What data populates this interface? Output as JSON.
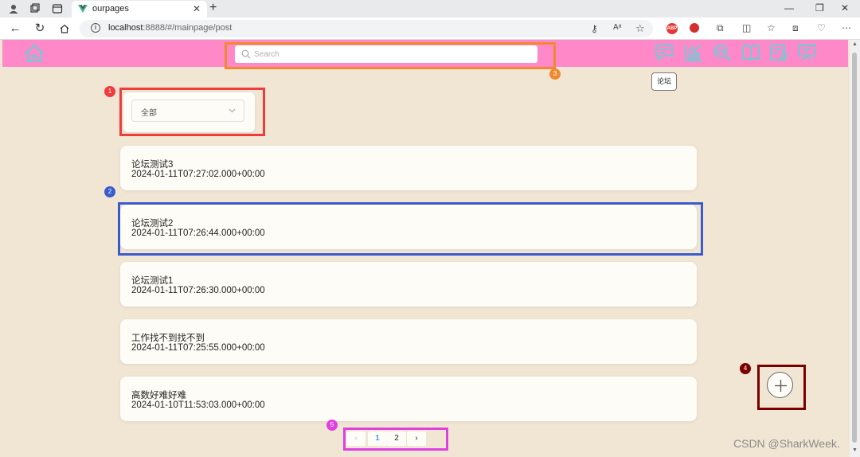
{
  "browser": {
    "tab_title": "ourpages",
    "url_host": "localhost",
    "url_rest": ":8888/#/mainpage/post"
  },
  "header": {
    "search_placeholder": "Search",
    "tooltip": "论坛",
    "icons": [
      "home-icon",
      "forum-icon",
      "stats-icon",
      "search-job-icon",
      "book-icon",
      "note-icon",
      "presentation-icon"
    ]
  },
  "filter": {
    "selected": "全部"
  },
  "posts": [
    {
      "title": "论坛测试3",
      "time": "2024-01-11T07:27:02.000+00:00"
    },
    {
      "title": "论坛测试2",
      "time": "2024-01-11T07:26:44.000+00:00"
    },
    {
      "title": "论坛测试1",
      "time": "2024-01-11T07:26:30.000+00:00"
    },
    {
      "title": "工作找不到找不到",
      "time": "2024-01-11T07:25:55.000+00:00"
    },
    {
      "title": "高数好难好难",
      "time": "2024-01-10T11:53:03.000+00:00"
    }
  ],
  "pagination": {
    "prev": "‹",
    "pages": [
      "1",
      "2"
    ],
    "current": "1",
    "next": "›"
  },
  "annotations": {
    "labels": [
      "1",
      "2",
      "3",
      "4",
      "5"
    ],
    "colors": [
      "#f03c3c",
      "#3b5bcc",
      "#f08a30",
      "#7a0000",
      "#e040e0"
    ]
  },
  "watermark": "CSDN @SharkWeek."
}
